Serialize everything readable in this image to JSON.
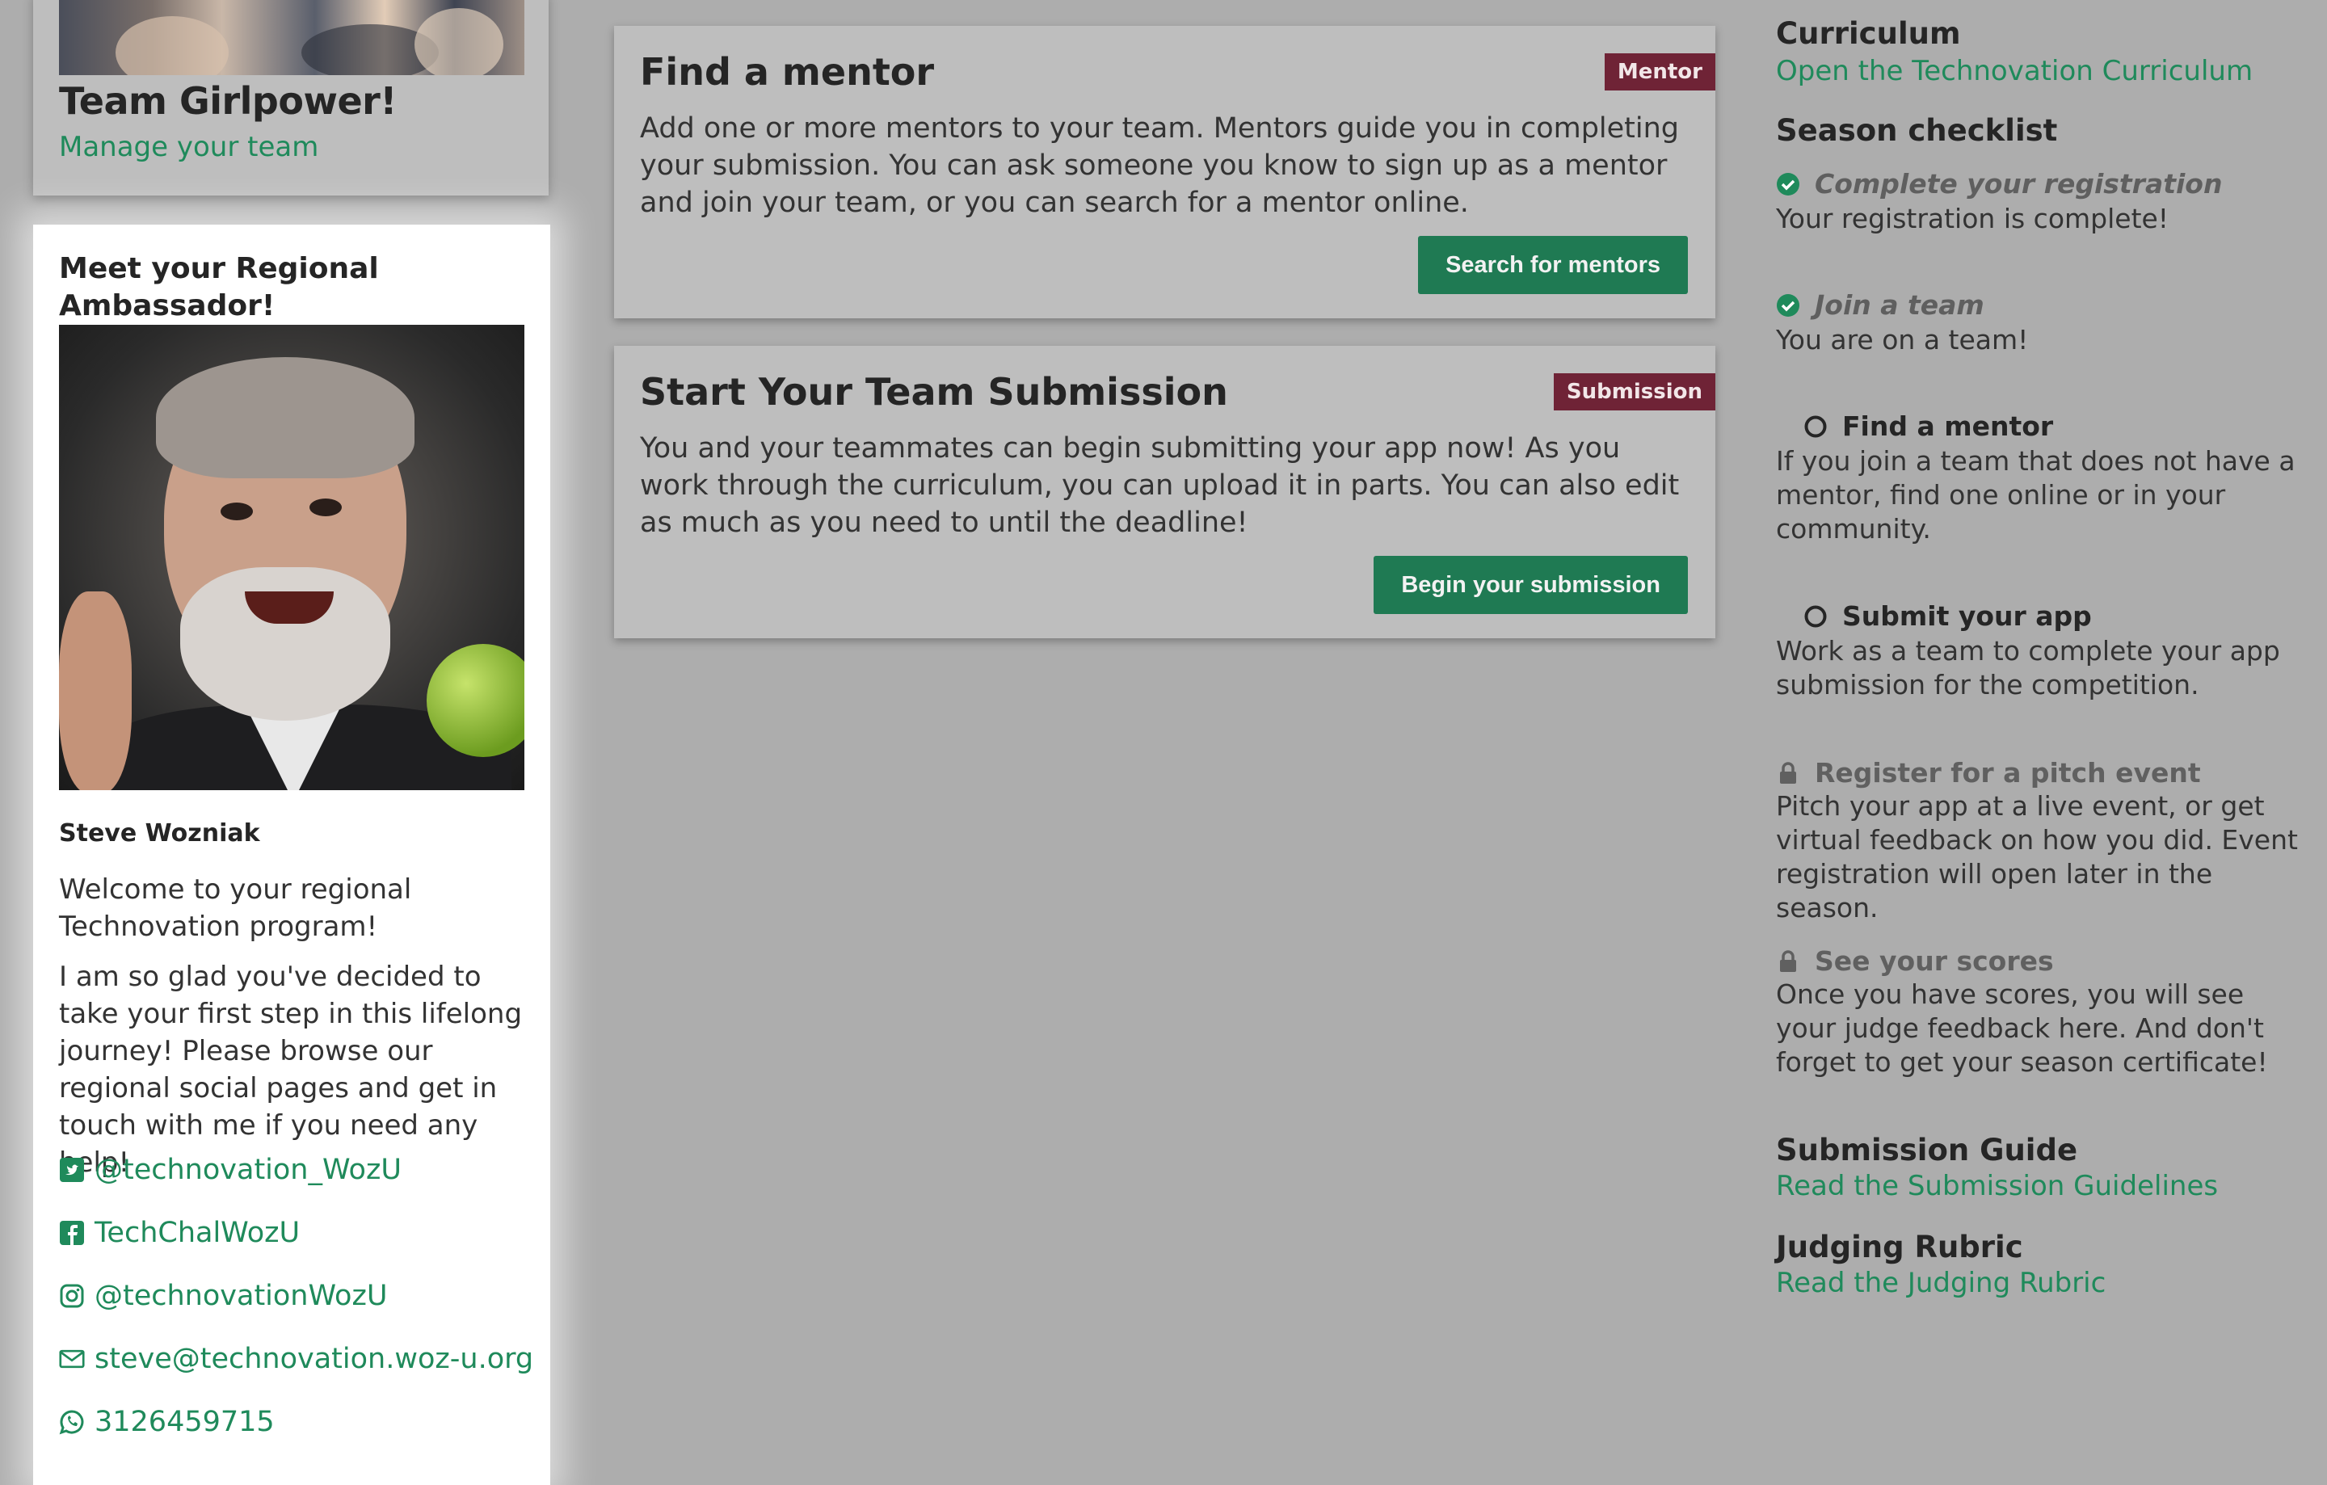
{
  "team": {
    "name": "Team Girlpower!",
    "manage_link": "Manage your team"
  },
  "ambassador": {
    "heading": "Meet your Regional Ambassador!",
    "name": "Steve Wozniak",
    "welcome": "Welcome to your regional Technovation program!",
    "message": "I am so glad you've decided to take your first step in this lifelong journey! Please browse our regional social pages and get in touch with me if you need any help!",
    "twitter": "@technovation_WozU",
    "facebook": "TechChalWozU",
    "instagram": "@technovationWozU",
    "email": "steve@technovation.woz-u.org",
    "phone": "3126459715"
  },
  "cards": [
    {
      "title": "Find a mentor",
      "tag": "Mentor",
      "body": "Add one or more mentors to your team. Mentors guide you in completing your submission. You can ask someone you know to sign up as a mentor and join your team, or you can search for a mentor online.",
      "button": "Search for mentors"
    },
    {
      "title": "Start Your Team Submission",
      "tag": "Submission",
      "body": "You and your teammates can begin submitting your app now! As you work through the curriculum, you can upload it in parts. You can also edit as much as you need to until the deadline!",
      "button": "Begin your submission"
    }
  ],
  "sidebar": {
    "curriculum_heading": "Curriculum",
    "curriculum_link": "Open the Technovation Curriculum",
    "checklist_heading": "Season checklist",
    "checklist": [
      {
        "title": "Complete your registration",
        "desc": "Your registration is complete!",
        "state": "done"
      },
      {
        "title": "Join a team",
        "desc": "You are on a team!",
        "state": "done"
      },
      {
        "title": "Find a mentor",
        "desc": "If you join a team that does not have a mentor, find one online or in your community.",
        "state": "open"
      },
      {
        "title": "Submit your app",
        "desc": "Work as a team to complete your app submission for the competition.",
        "state": "open"
      },
      {
        "title": "Register for a pitch event",
        "desc": "Pitch your app at a live event, or get virtual feedback on how you did. Event registration will open later in the season.",
        "state": "locked"
      },
      {
        "title": "See your scores",
        "desc": "Once you have scores, you will see your judge feedback here. And don't forget to get your season certificate!",
        "state": "locked"
      }
    ],
    "guide_heading": "Submission Guide",
    "guide_link": "Read the Submission Guidelines",
    "rubric_heading": "Judging Rubric",
    "rubric_link": "Read the Judging Rubric"
  },
  "colors": {
    "background": "#adadad",
    "link": "#1f8a5b",
    "button": "#1f7a53",
    "tag": "#6f2336"
  }
}
